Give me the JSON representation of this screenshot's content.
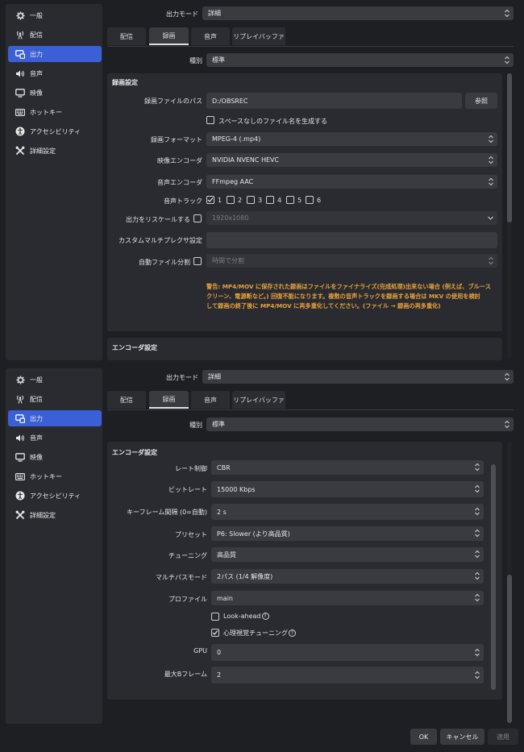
{
  "sidebar": {
    "items": [
      {
        "label": "一般",
        "icon": "gear-icon"
      },
      {
        "label": "配信",
        "icon": "broadcast-icon"
      },
      {
        "label": "出力",
        "icon": "output-monitor-icon"
      },
      {
        "label": "音声",
        "icon": "speaker-icon"
      },
      {
        "label": "映像",
        "icon": "monitor-icon"
      },
      {
        "label": "ホットキー",
        "icon": "keyboard-icon"
      },
      {
        "label": "アクセシビリティ",
        "icon": "accessibility-icon"
      },
      {
        "label": "詳細設定",
        "icon": "tools-icon"
      }
    ],
    "selected": "出力"
  },
  "output_mode": {
    "label": "出力モード",
    "value": "詳細"
  },
  "tabs": [
    "配信",
    "録画",
    "音声",
    "リプレイバッファ"
  ],
  "selected_tab": "録画",
  "type": {
    "label": "種別",
    "value": "標準"
  },
  "recording": {
    "group_title": "録画設定",
    "path_label": "録画ファイルのパス",
    "path_value": "D:/OBSREC",
    "browse_label": "参照",
    "no_space_label": "スペースなしのファイル名を生成する",
    "format_label": "録画フォーマット",
    "format_value": "MPEG-4 (.mp4)",
    "video_encoder_label": "映像エンコーダ",
    "video_encoder_value": "NVIDIA NVENC HEVC",
    "audio_encoder_label": "音声エンコーダ",
    "audio_encoder_value": "FFmpeg AAC",
    "audio_track_label": "音声トラック",
    "tracks": [
      "1",
      "2",
      "3",
      "4",
      "5",
      "6"
    ],
    "rescale_label": "出力をリスケールする",
    "rescale_value": "1920x1080",
    "muxer_label": "カスタムマルチプレクサ設定",
    "autosplit_label": "自動ファイル分割",
    "autosplit_value": "時間で分割",
    "warning_line1": "警告: MP4/MOV に保存された録画はファイルをファイナライズ(完成処理)出来ない場合 (例えば、ブルース",
    "warning_line2": "クリーン、電源断など。) 回復不能になります。複数の音声トラックを録画する場合は MKV の使用を検討",
    "warning_line3": "して録画の終了後に MP4/MOV に再多重化してください。(ファイル → 録画の再多重化)"
  },
  "encoder": {
    "group_title": "エンコーダ設定",
    "rate_control_label": "レート制御",
    "rate_control_value": "CBR",
    "bitrate_label": "ビットレート",
    "bitrate_value": "15000 Kbps",
    "keyframe_label": "キーフレーム間隔 (0=自動)",
    "keyframe_value": "2 s",
    "preset_label": "プリセット",
    "preset_value": "P6: Slower (より高品質)",
    "tuning_label": "チューニング",
    "tuning_value": "高品質",
    "multipass_label": "マルチパスモード",
    "multipass_value": "2パス (1/4 解像度)",
    "profile_label": "プロファイル",
    "profile_value": "main",
    "lookahead_label": "Look-ahead",
    "psycho_label": "心理視覚チューニング",
    "gpu_label": "GPU",
    "gpu_value": "0",
    "bframes_label": "最大Bフレーム",
    "bframes_value": "2"
  },
  "buttons": {
    "ok": "OK",
    "cancel": "キャンセル",
    "apply": "適用"
  },
  "colors": {
    "accent": "#3a5fd6",
    "warning": "#e9a23b",
    "background": "#1e1f23"
  }
}
